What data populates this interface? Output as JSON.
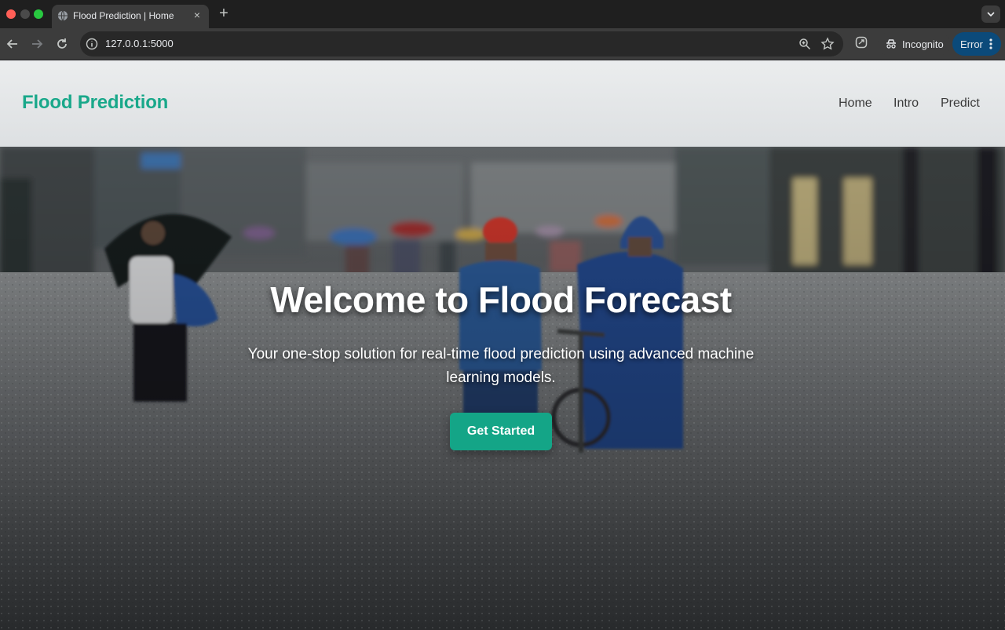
{
  "browser": {
    "tab_title": "Flood Prediction | Home",
    "tab_close": "×",
    "new_tab": "+",
    "url": "127.0.0.1:5000",
    "incognito_label": "Incognito",
    "error_label": "Error",
    "icons": [
      "globe-icon",
      "back-arrow-icon",
      "forward-arrow-icon",
      "reload-icon",
      "site-info-icon",
      "zoom-icon",
      "bookmark-star-icon",
      "extension-icon",
      "incognito-icon",
      "kebab-menu-icon",
      "tab-search-icon"
    ]
  },
  "page": {
    "brand": "Flood Prediction",
    "nav": [
      "Home",
      "Intro",
      "Predict"
    ],
    "hero": {
      "title": "Welcome to Flood Forecast",
      "subtitle": "Your one-stop solution for real-time flood prediction using advanced machine learning models.",
      "cta_label": "Get Started"
    },
    "colors": {
      "brand": "#19a88a",
      "cta": "#14a587",
      "nav_text": "#3a3a3a"
    }
  }
}
